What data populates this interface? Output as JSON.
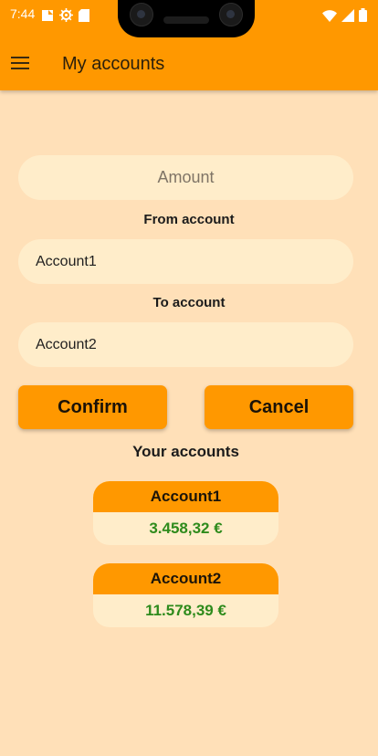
{
  "status_bar": {
    "time": "7:44",
    "left_icons": [
      "notification-icon",
      "settings-icon",
      "sd-card-icon"
    ],
    "right_icons": [
      "wifi-icon",
      "signal-icon",
      "battery-icon"
    ]
  },
  "app_bar": {
    "title": "My accounts",
    "menu_icon": "hamburger-menu-icon"
  },
  "form": {
    "amount_placeholder": "Amount",
    "from_label": "From account",
    "from_value": "Account1",
    "to_label": "To account",
    "to_value": "Account2",
    "confirm_label": "Confirm",
    "cancel_label": "Cancel"
  },
  "accounts_section": {
    "title": "Your accounts",
    "accounts": [
      {
        "name": "Account1",
        "balance": "3.458,32 €"
      },
      {
        "name": "Account2",
        "balance": "11.578,39 €"
      }
    ]
  },
  "colors": {
    "primary": "#ff9800",
    "background": "#ffe0b8",
    "field": "#ffedca",
    "balance": "#2e8b1c"
  }
}
